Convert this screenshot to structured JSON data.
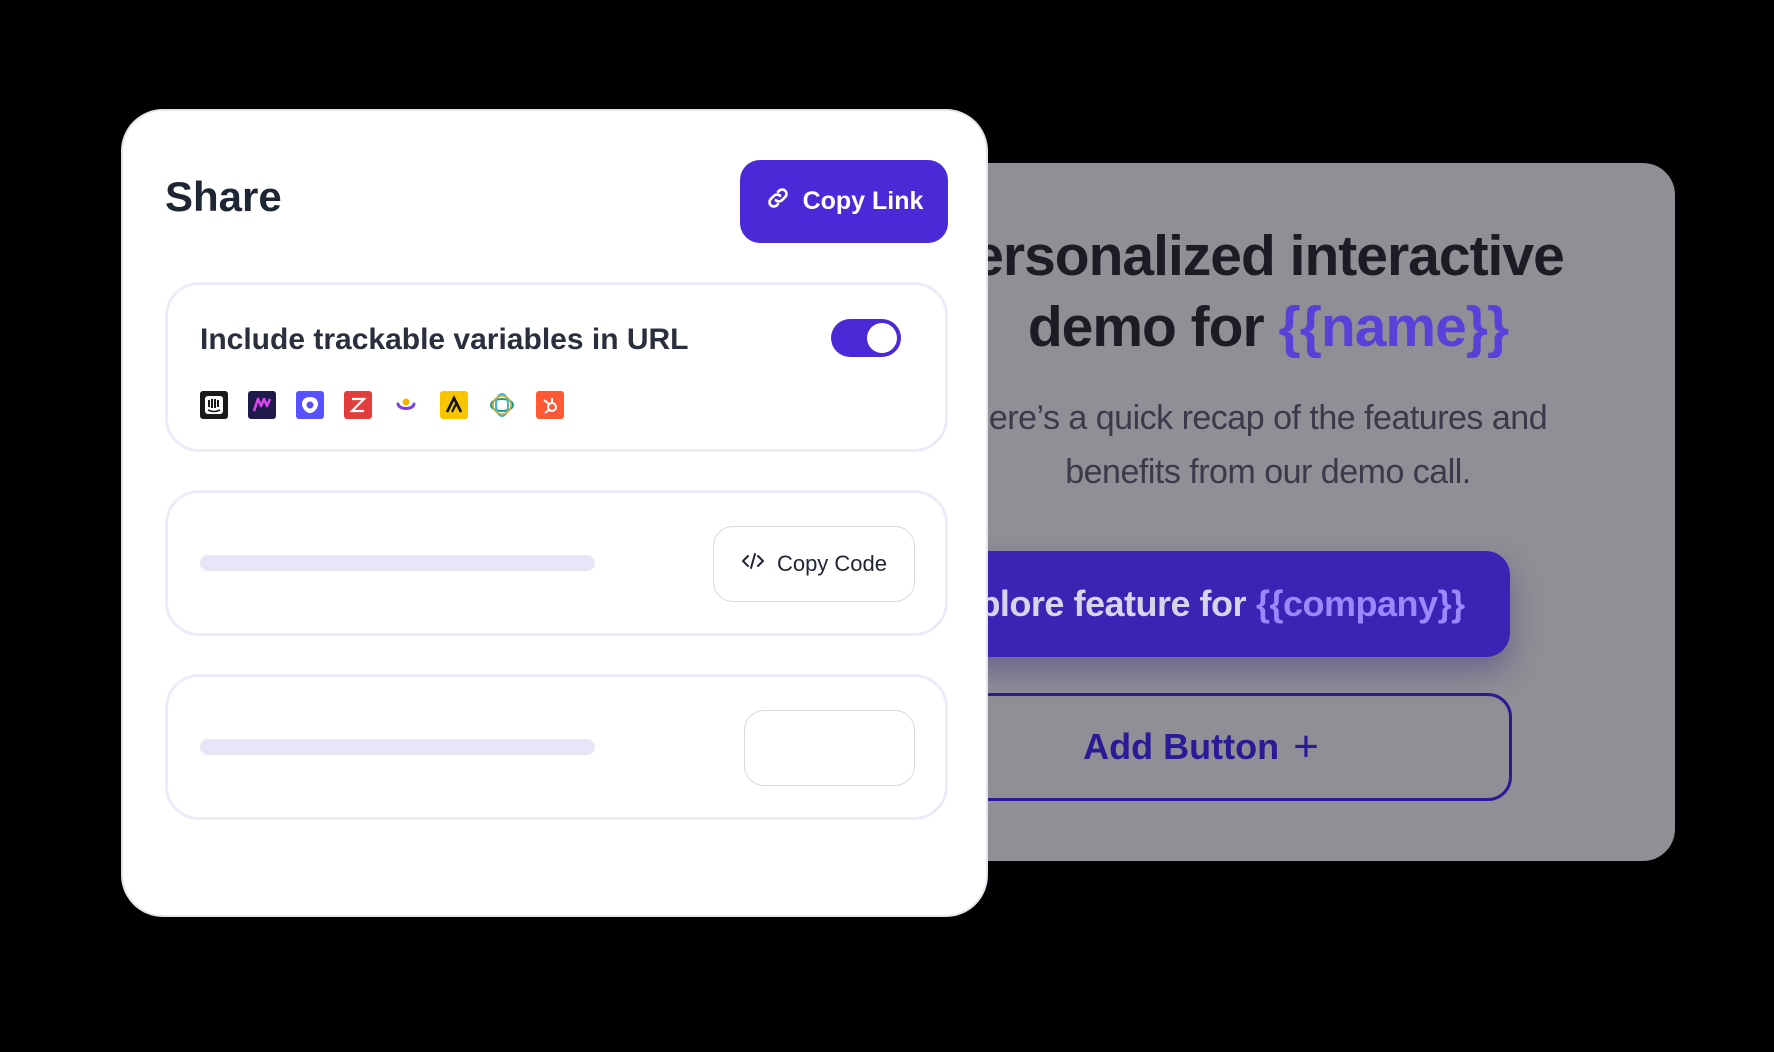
{
  "demo_card": {
    "title_line1": "ersonalized interactive",
    "title_line2_prefix": "demo for",
    "title_line2_var": "{{name}}",
    "subtitle_line1": "ere’s a quick recap of the features and",
    "subtitle_line2": "benefits from our demo call.",
    "explore_button_prefix": "Explore feature for",
    "explore_button_var": "{{company}}",
    "add_button_label": "Add Button",
    "add_button_icon": "plus-icon"
  },
  "share": {
    "title": "Share",
    "copy_link_label": "Copy Link",
    "copy_link_icon": "link-icon",
    "trackable": {
      "label": "Include trackable variables in URL",
      "enabled": true,
      "integration_icons": [
        "intercom-icon",
        "marketo-icon",
        "outreach-icon",
        "zoominfo-icon",
        "customerio-icon",
        "apollo-icon",
        "salesloft-icon",
        "hubspot-icon"
      ]
    },
    "embed": {
      "copy_code_label": "Copy Code",
      "copy_code_icon": "code-icon"
    }
  },
  "colors": {
    "accent": "#4a2ad6",
    "variable_text": "#5b3fd9",
    "background": "#000000",
    "card_overlay": "#8f8f95"
  }
}
